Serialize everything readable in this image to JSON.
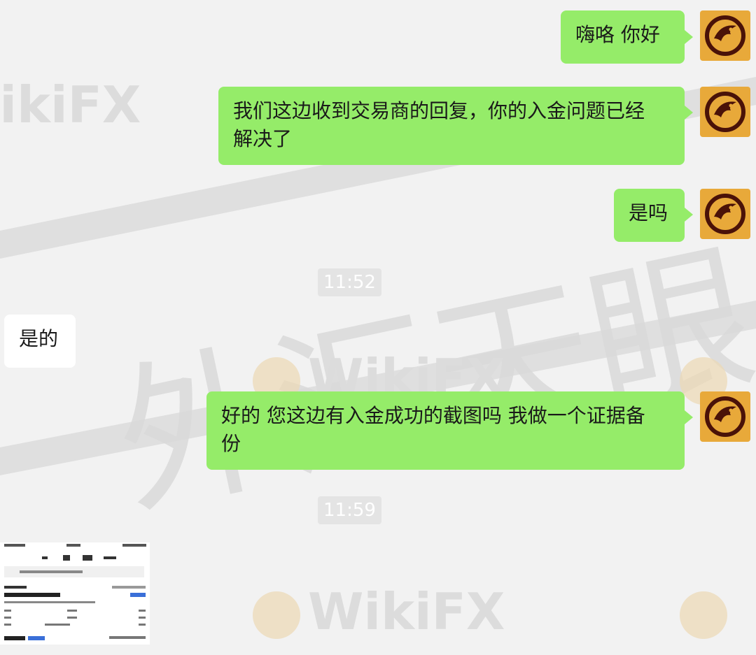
{
  "messages": [
    {
      "side": "right",
      "text": "嗨咯 你好"
    },
    {
      "side": "right",
      "text_line1": "我们这边收到交易商的回复，你的入金问题已经",
      "text_line2": "解决了"
    },
    {
      "side": "right",
      "text": "是吗"
    },
    {
      "side": "left",
      "text": "是的"
    },
    {
      "side": "right",
      "text_line1": "好的 您这边有入金成功的截图吗 我做一个证据备",
      "text_line2": "份"
    }
  ],
  "timestamps": [
    "11:52",
    "11:59"
  ],
  "watermark": {
    "text": "WikiFX",
    "cn_text": "外汇天眼"
  },
  "colors": {
    "outgoing_bubble": "#95ec69",
    "incoming_bubble": "#ffffff",
    "background": "#f2f2f2",
    "avatar_bg": "#e8a93a",
    "avatar_fg": "#4a1208"
  },
  "avatar_icon": "eagle-logo-icon",
  "attachment_icon": "screenshot-image-thumbnail"
}
